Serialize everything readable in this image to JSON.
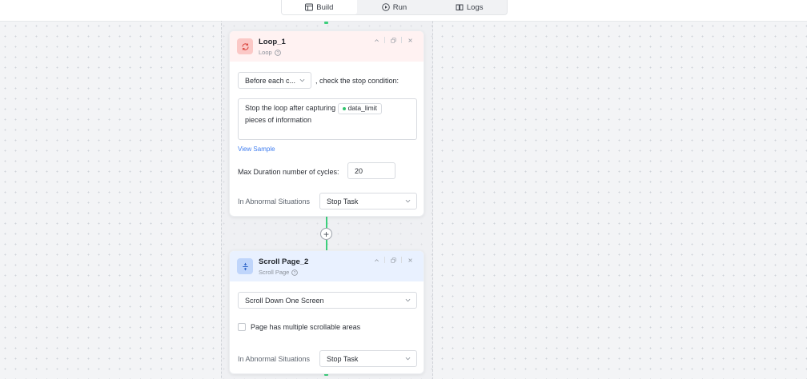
{
  "tabs": [
    {
      "label": "Build",
      "icon": "build-icon"
    },
    {
      "label": "Run",
      "icon": "run-icon"
    },
    {
      "label": "Logs",
      "icon": "logs-icon"
    }
  ],
  "loop_node": {
    "title": "Loop_1",
    "subtitle": "Loop",
    "timing_select": "Before each c...",
    "condition_suffix": ", check the stop condition:",
    "condition_prefix": "Stop the loop after capturing",
    "variable_chip": "data_limit",
    "condition_tail": "pieces of information",
    "view_sample": "View Sample",
    "max_duration_label": "Max Duration number of cycles:",
    "max_duration_value": "20",
    "abnormal_label": "In Abnormal Situations",
    "abnormal_value": "Stop Task",
    "accent": "#fbc8c6"
  },
  "scroll_node": {
    "title": "Scroll Page_2",
    "subtitle": "Scroll Page",
    "scroll_select": "Scroll Down One Screen",
    "multiple_areas_label": "Page has multiple scrollable areas",
    "multiple_areas_checked": false,
    "abnormal_label": "In Abnormal Situations",
    "abnormal_value": "Stop Task",
    "accent": "#bfd5fb"
  },
  "add_step": "+",
  "colors": {
    "connector": "#3ccf7c",
    "link": "#3f7df0",
    "loop_header": "#fff2f2",
    "scroll_header": "#e9f1ff"
  }
}
